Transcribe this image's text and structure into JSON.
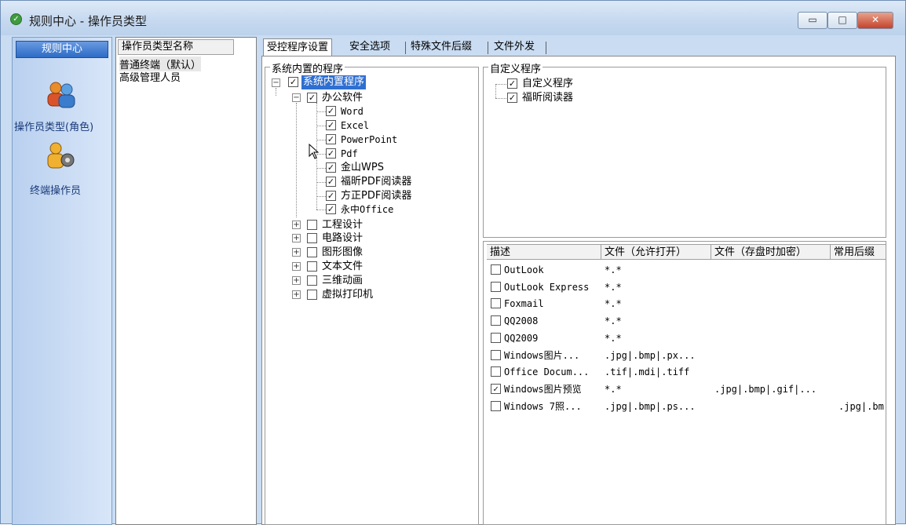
{
  "window": {
    "title": "规则中心 - 操作员类型"
  },
  "titlebar_buttons": {
    "min": "▭",
    "max": "□",
    "close": "✕"
  },
  "leftnav": {
    "header": "规则中心",
    "items": [
      {
        "label": "操作员类型(角色)",
        "icon": "users-icon"
      },
      {
        "label": "终端操作员",
        "icon": "user-gear-icon"
      }
    ]
  },
  "operator_types": {
    "header": "操作员类型名称",
    "items": [
      "普通终端（默认）",
      "高级管理人员"
    ]
  },
  "tabs": [
    "受控程序设置",
    "安全选项",
    "特殊文件后缀",
    "文件外发"
  ],
  "builtin": {
    "title": "系统内置的程序",
    "root": "系统内置程序",
    "office": {
      "label": "办公软件",
      "children": [
        "Word",
        "Excel",
        "PowerPoint",
        "Pdf",
        "金山WPS",
        "福昕PDF阅读器",
        "方正PDF阅读器",
        "永中Office"
      ]
    },
    "others": [
      "工程设计",
      "电路设计",
      "图形图像",
      "文本文件",
      "三维动画",
      "虚拟打印机"
    ]
  },
  "custom": {
    "title": "自定义程序",
    "root": "自定义程序",
    "child": "福昕阅读器"
  },
  "file_table": {
    "headers": [
      "描述",
      "文件（允许打开）",
      "文件（存盘时加密）",
      "常用后缀"
    ],
    "rows": [
      {
        "desc": "OutLook",
        "allow": "*.*",
        "encrypt": "",
        "suffix": "",
        "checked": false
      },
      {
        "desc": "OutLook Express",
        "allow": "*.*",
        "encrypt": "",
        "suffix": "",
        "checked": false
      },
      {
        "desc": "Foxmail",
        "allow": "*.*",
        "encrypt": "",
        "suffix": "",
        "checked": false
      },
      {
        "desc": "QQ2008",
        "allow": "*.*",
        "encrypt": "",
        "suffix": "",
        "checked": false
      },
      {
        "desc": "QQ2009",
        "allow": "*.*",
        "encrypt": "",
        "suffix": "",
        "checked": false
      },
      {
        "desc": "Windows图片...",
        "allow": ".jpg|.bmp|.px...",
        "encrypt": "",
        "suffix": "",
        "checked": false
      },
      {
        "desc": "Office Docum...",
        "allow": ".tif|.mdi|.tiff",
        "encrypt": "",
        "suffix": "",
        "checked": false
      },
      {
        "desc": "Windows图片预览",
        "allow": "*.*",
        "encrypt": ".jpg|.bmp|.gif|...",
        "suffix": "",
        "checked": true
      },
      {
        "desc": "Windows 7照...",
        "allow": ".jpg|.bmp|.ps...",
        "encrypt": "",
        "suffix": ".jpg|.bm",
        "checked": false
      }
    ]
  }
}
